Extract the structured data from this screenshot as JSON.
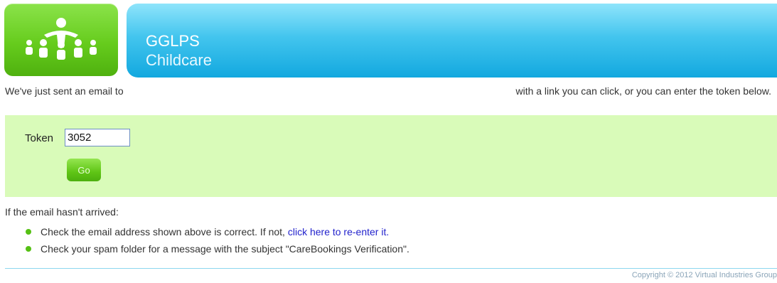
{
  "header": {
    "logo_icon": "group-of-people-icon",
    "title": "GGLPS",
    "subtitle": "Childcare"
  },
  "intro": {
    "left": "We've just sent an email to",
    "right": "with a link you can click, or you can enter the token below."
  },
  "token_form": {
    "label": "Token",
    "value": "3052",
    "go_label": "Go"
  },
  "help": {
    "title": "If the email hasn't arrived:",
    "item1_text": "Check the email address shown above is correct. If not,",
    "item1_link": "click here to re-enter it.",
    "item2_text": "Check your spam folder for a message with the subject \"CareBookings Verification\"."
  },
  "footer": {
    "copyright": "Copyright © 2012 Virtual Industries Group"
  },
  "colors": {
    "banner": "#29b8e8",
    "logo_green": "#66cc1d",
    "token_panel": "#d9fbb9",
    "link": "#2323cc"
  }
}
